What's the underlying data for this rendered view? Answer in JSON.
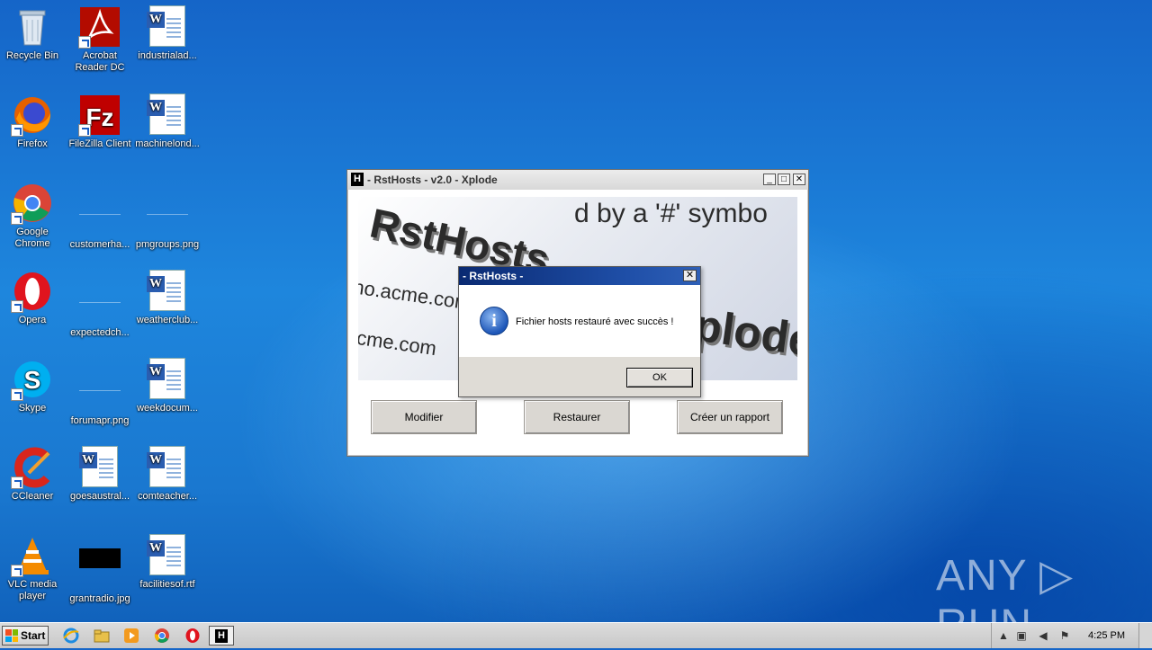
{
  "desktop": {
    "icons": [
      {
        "label": "Recycle Bin",
        "icon": "recycle-bin-icon"
      },
      {
        "label": "Acrobat Reader DC",
        "icon": "acrobat-icon"
      },
      {
        "label": "industrialad...",
        "icon": "word-doc-icon"
      },
      {
        "label": "Firefox",
        "icon": "firefox-icon"
      },
      {
        "label": "FileZilla Client",
        "icon": "filezilla-icon"
      },
      {
        "label": "machinelond...",
        "icon": "word-doc-icon"
      },
      {
        "label": "Google Chrome",
        "icon": "chrome-icon"
      },
      {
        "label": "customerha...",
        "icon": "image-file-icon"
      },
      {
        "label": "pmgroups.png",
        "icon": "image-file-icon"
      },
      {
        "label": "Opera",
        "icon": "opera-icon"
      },
      {
        "label": "expectedch...",
        "icon": "image-file-icon"
      },
      {
        "label": "weatherclub...",
        "icon": "word-doc-icon"
      },
      {
        "label": "Skype",
        "icon": "skype-icon"
      },
      {
        "label": "forumapr.png",
        "icon": "image-file-icon"
      },
      {
        "label": "weekdocum...",
        "icon": "word-doc-icon"
      },
      {
        "label": "CCleaner",
        "icon": "ccleaner-icon"
      },
      {
        "label": "goesaustral...",
        "icon": "word-doc-icon"
      },
      {
        "label": "comteacher...",
        "icon": "word-doc-icon"
      },
      {
        "label": "VLC media player",
        "icon": "vlc-icon"
      },
      {
        "label": "grantradio.jpg",
        "icon": "image-file-icon"
      },
      {
        "label": "facilitiesof.rtf",
        "icon": "word-doc-icon"
      }
    ]
  },
  "main_window": {
    "title": "- RstHosts - v2.0 - Xplode",
    "title_icon": "H",
    "banner": {
      "line1": "d by a '#' symbo",
      "line2": "RstHosts",
      "line3": "Xplode",
      "line4": "no.acme.con",
      "line5": "cme.com"
    },
    "buttons": {
      "modify": "Modifier",
      "restore": "Restaurer",
      "report": "Créer un rapport"
    },
    "controls": {
      "minimize": "_",
      "maximize": "□",
      "close": "✕"
    }
  },
  "message_box": {
    "title": "- RstHosts -",
    "close": "✕",
    "icon": "info-icon",
    "info_glyph": "i",
    "message": "Fichier hosts restauré avec succès !",
    "ok": "OK"
  },
  "watermark": {
    "text": "ANY ▷ RUN"
  },
  "taskbar": {
    "start_label": "Start",
    "apps": [
      "ie-icon",
      "explorer-icon",
      "media-player-icon",
      "chrome-icon",
      "opera-icon",
      "rsthosts-icon"
    ],
    "rsthosts_glyph": "H",
    "clock": "4:25 PM"
  },
  "colors": {
    "desktop_blue": "#1a78d0",
    "message_title_blue": "#0a2a72",
    "button_face": "#dad7d2"
  }
}
